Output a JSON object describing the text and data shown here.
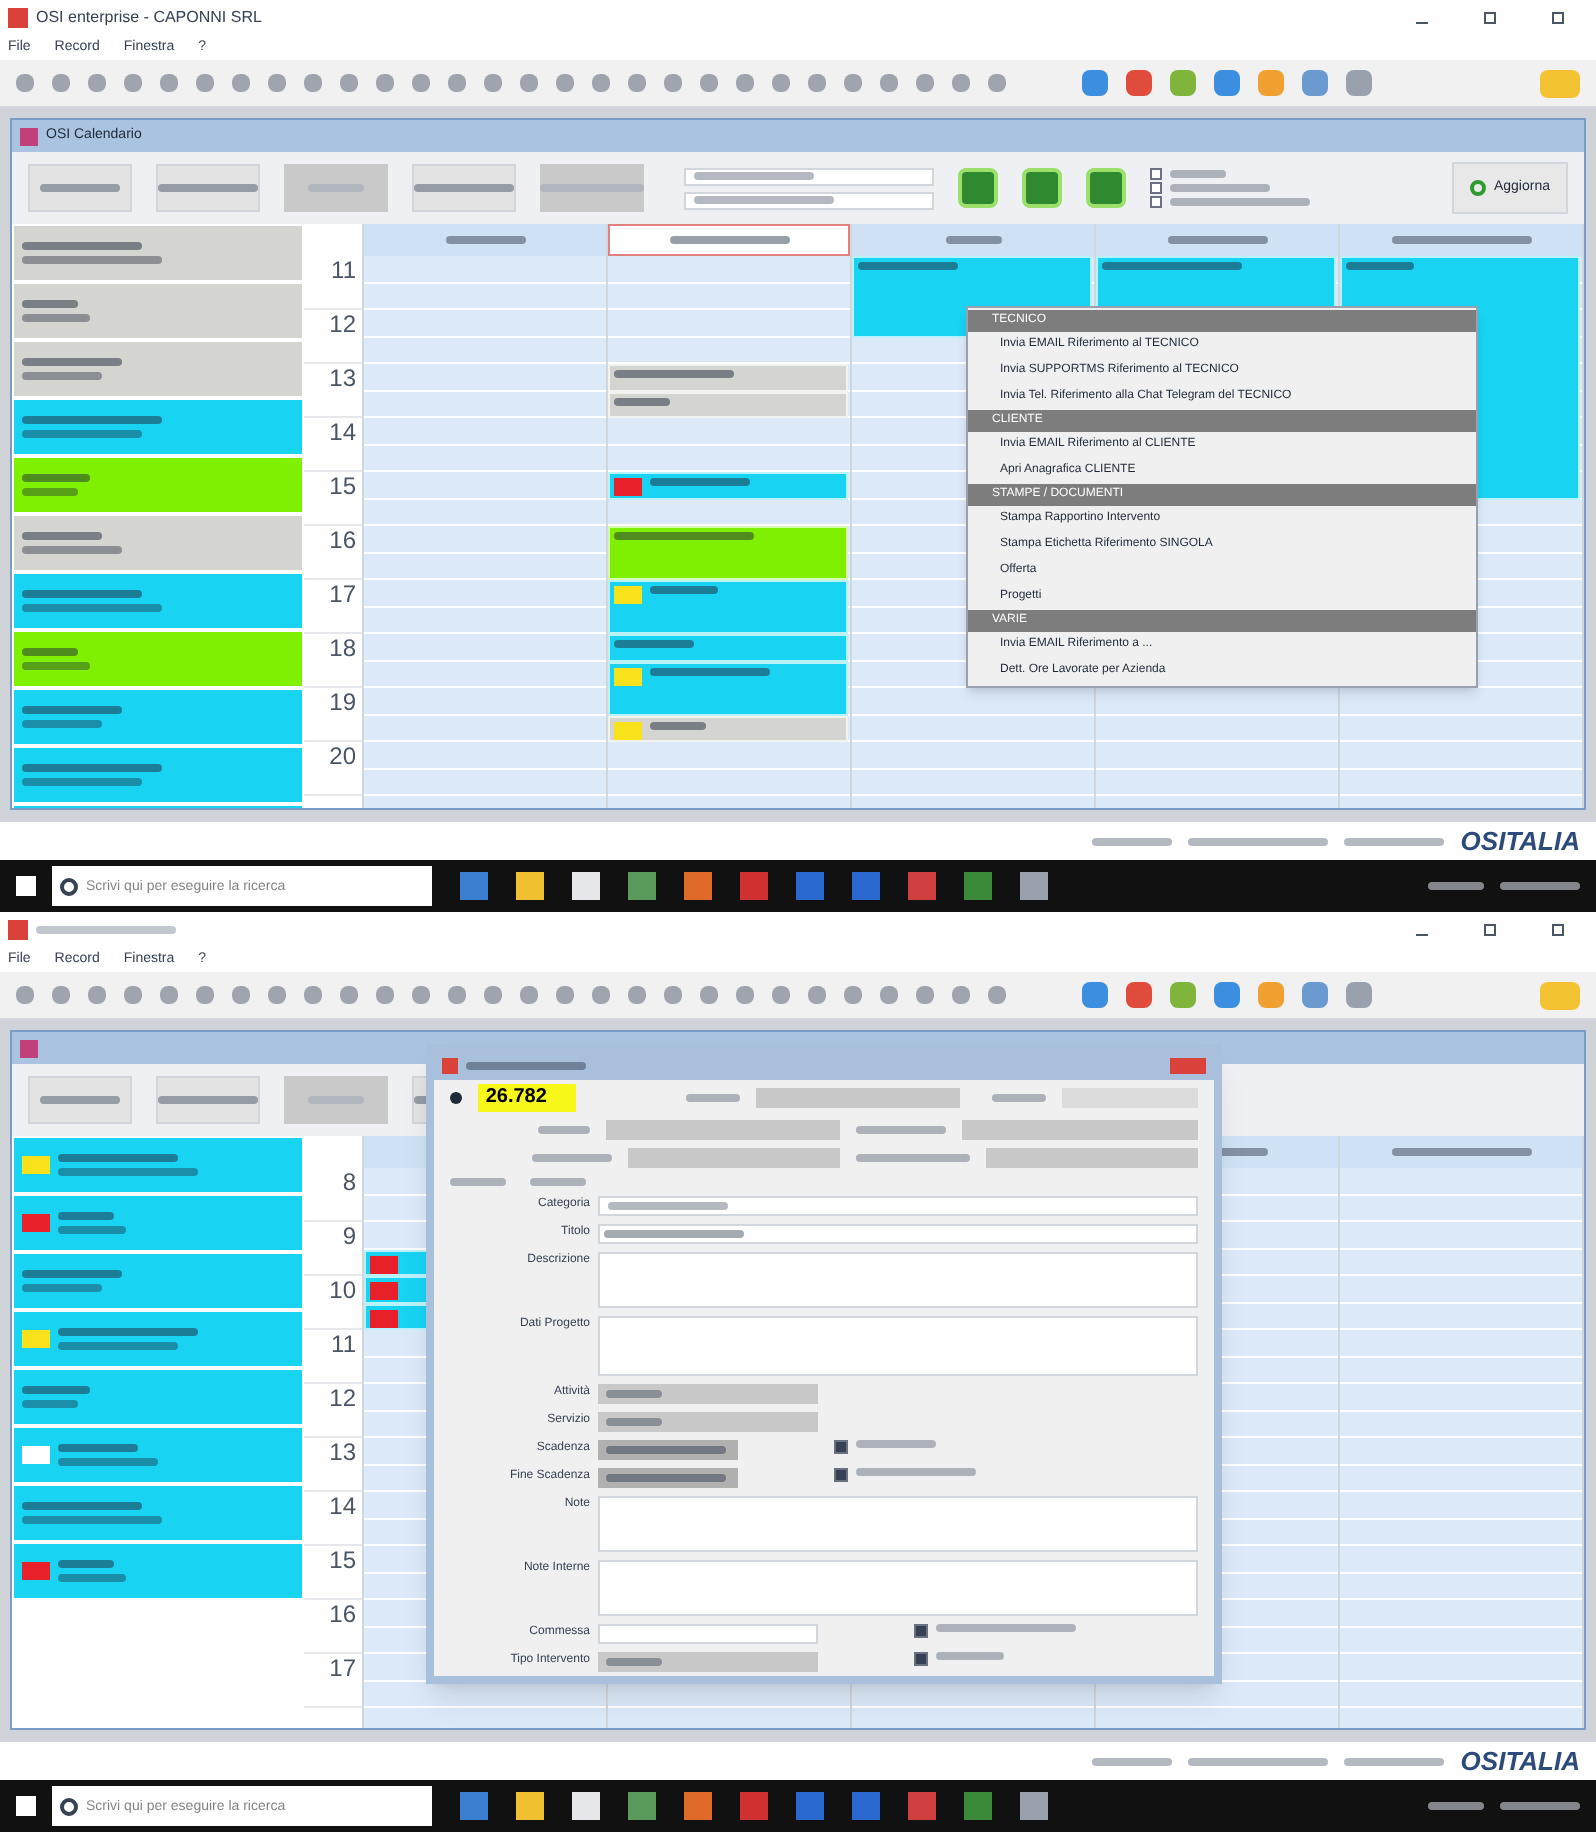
{
  "screens": [
    {
      "kind": "menu_view",
      "window_title": "OSI enterprise - CAPONNI SRL",
      "menu": [
        "File",
        "Record",
        "Finestra",
        "?"
      ],
      "inner_title": "OSI Calendario",
      "buttons": [
        {
          "disabled": false
        },
        {
          "disabled": false
        },
        {
          "disabled": true
        },
        {
          "disabled": false
        },
        {
          "disabled": true
        }
      ],
      "filters": [
        {
          "checked": false
        },
        {
          "checked": false
        },
        {
          "checked": false
        }
      ],
      "refresh_button": "Aggiorna",
      "hours": [
        "11",
        "12",
        "13",
        "14",
        "15",
        "16",
        "17",
        "18",
        "19",
        "20"
      ],
      "sidebar_cards": [
        {
          "color": "#d4d4d0"
        },
        {
          "color": "#d4d4d0"
        },
        {
          "color": "#d4d4d0"
        },
        {
          "color": "#19d3f3"
        },
        {
          "color": "#7ef000"
        },
        {
          "color": "#d4d4d0"
        },
        {
          "color": "#19d3f3"
        },
        {
          "color": "#7ef000"
        },
        {
          "color": "#19d3f3"
        },
        {
          "color": "#19d3f3"
        },
        {
          "color": "#19d3f3"
        }
      ],
      "days": [
        {
          "selected": false
        },
        {
          "selected": true
        },
        {
          "selected": false
        },
        {
          "selected": false
        },
        {
          "selected": false
        }
      ],
      "events": [
        {
          "color": "#d4d4d0"
        },
        {
          "color": "#d4d4d0"
        },
        {
          "color": "#19d3f3",
          "marker": {
            "color": "#e8202a"
          }
        },
        {
          "color": "#7ef000"
        },
        {
          "color": "#19d3f3",
          "marker": {
            "color": "#f7e21b"
          }
        },
        {
          "color": "#19d3f3"
        },
        {
          "color": "#19d3f3",
          "marker": {
            "color": "#f7e21b"
          }
        },
        {
          "color": "#d4d4d0",
          "marker": {
            "color": "#f7e21b"
          }
        },
        {
          "color": "#19d3f3"
        },
        {
          "color": "#19d3f3"
        },
        {
          "color": "#19d3f3"
        }
      ],
      "context_menu": [
        {
          "kind": "header",
          "label": "TECNICO"
        },
        {
          "kind": "item",
          "label": "Invia EMAIL Riferimento al TECNICO"
        },
        {
          "kind": "item",
          "label": "Invia SUPPORTMS Riferimento al TECNICO"
        },
        {
          "kind": "item",
          "label": "Invia Tel. Riferimento alla Chat Telegram del TECNICO"
        },
        {
          "kind": "header",
          "label": "CLIENTE"
        },
        {
          "kind": "item",
          "label": "Invia EMAIL Riferimento al CLIENTE"
        },
        {
          "kind": "item",
          "label": "Apri Anagrafica CLIENTE"
        },
        {
          "kind": "header",
          "label": "STAMPE / DOCUMENTI"
        },
        {
          "kind": "item",
          "label": "Stampa Rapportino Intervento"
        },
        {
          "kind": "item",
          "label": "Stampa Etichetta Riferimento SINGOLA"
        },
        {
          "kind": "item",
          "label": "Offerta"
        },
        {
          "kind": "item",
          "label": "Progetti"
        },
        {
          "kind": "header",
          "label": "VARIE"
        },
        {
          "kind": "item",
          "label": "Invia EMAIL Riferimento a ..."
        },
        {
          "kind": "item",
          "label": "Dett. Ore Lavorate per Azienda"
        }
      ],
      "brand": "OSITALIA",
      "search_placeholder": "Scrivi qui per eseguire la ricerca"
    },
    {
      "kind": "dialog_view",
      "menu": [
        "File",
        "Record",
        "Finestra",
        "?"
      ],
      "buttons": [
        {
          "disabled": false
        },
        {
          "disabled": false
        },
        {
          "disabled": true
        },
        {
          "disabled": false
        }
      ],
      "hours": [
        "8",
        "9",
        "10",
        "11",
        "12",
        "13",
        "14",
        "15",
        "16",
        "17"
      ],
      "sidebar_cards": [
        {
          "color": "#19d3f3",
          "marker": {
            "color": "#f7e21b"
          }
        },
        {
          "color": "#19d3f3",
          "marker": {
            "color": "#e8202a"
          }
        },
        {
          "color": "#19d3f3"
        },
        {
          "color": "#19d3f3",
          "marker": {
            "color": "#f7e21b"
          }
        },
        {
          "color": "#19d3f3"
        },
        {
          "color": "#19d3f3",
          "marker": {
            "color": "#ffffff"
          }
        },
        {
          "color": "#19d3f3"
        },
        {
          "color": "#19d3f3",
          "marker": {
            "color": "#e8202a"
          }
        }
      ],
      "events": [
        {
          "color": "#19d3f3",
          "marker": {
            "color": "#e8202a"
          }
        },
        {
          "color": "#19d3f3",
          "marker": {
            "color": "#e8202a"
          }
        },
        {
          "color": "#19d3f3",
          "marker": {
            "color": "#e8202a"
          }
        }
      ],
      "dialog": {
        "number": "26.782",
        "rows": [
          {
            "kind": "combo",
            "label": "Categoria"
          },
          {
            "kind": "text",
            "label": "Titolo"
          },
          {
            "kind": "memo",
            "label": "Descrizione"
          },
          {
            "kind": "tall",
            "label": "Dati Progetto"
          },
          {
            "kind": "combo_short",
            "label": "Attività"
          },
          {
            "kind": "combo_short",
            "label": "Servizio"
          },
          {
            "kind": "date",
            "label": "Scadenza",
            "checked": true
          },
          {
            "kind": "date",
            "label": "Fine Scadenza",
            "checked": true
          },
          {
            "kind": "memo",
            "label": "Note"
          },
          {
            "kind": "memo",
            "label": "Note Interne"
          },
          {
            "kind": "text_short",
            "label": "Commessa",
            "checked": true
          },
          {
            "kind": "combo_short",
            "label": "Tipo Intervento",
            "checked": true
          }
        ]
      },
      "brand": "OSITALIA",
      "search_placeholder": "Scrivi qui per eseguire la ricerca"
    }
  ]
}
